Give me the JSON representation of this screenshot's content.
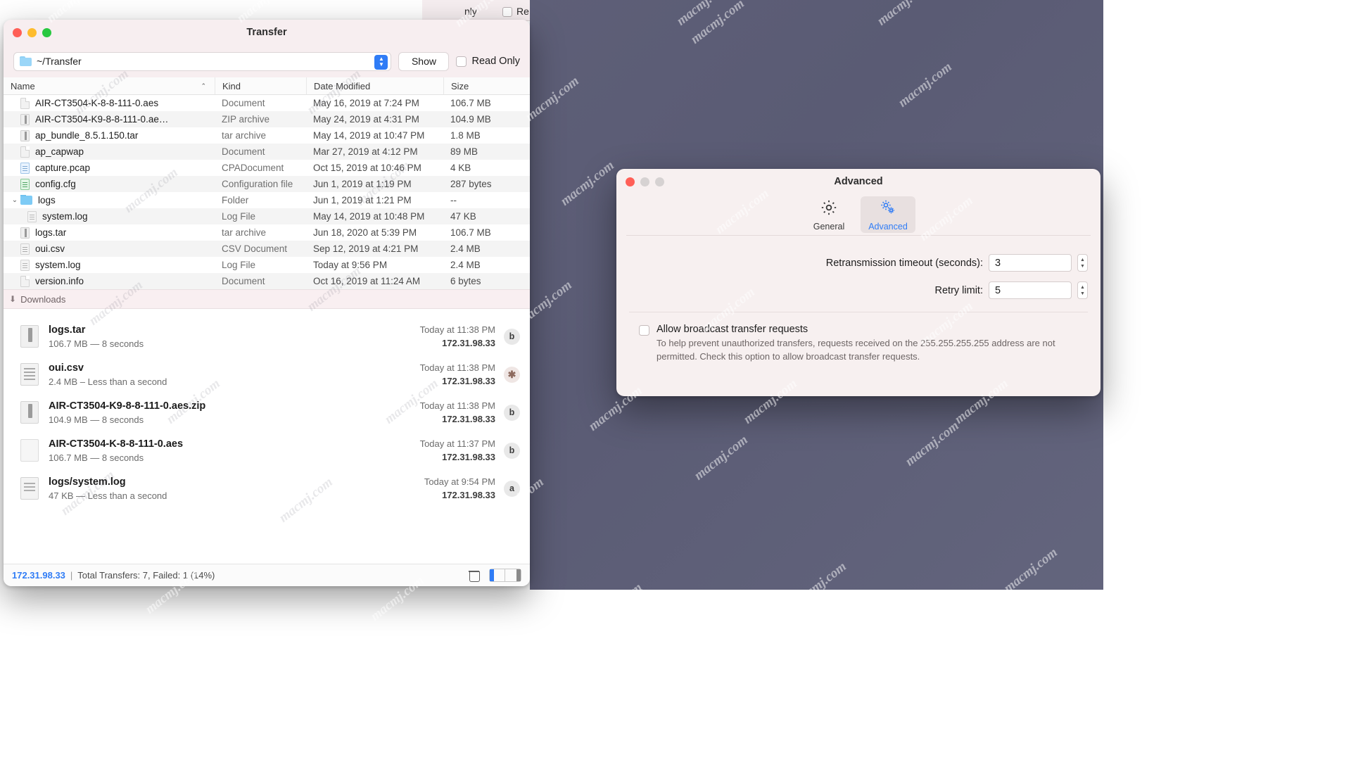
{
  "background": {
    "watermark_text": "macmj.com"
  },
  "behind_window": {
    "right_only_label": "nly",
    "readonly_label": "Re"
  },
  "transfer_window": {
    "title": "Transfer",
    "path": {
      "value": "~/Transfer",
      "folder_icon": "folder-icon"
    },
    "show_button": "Show",
    "read_only_label": "Read Only",
    "columns": [
      "Name",
      "Kind",
      "Date Modified",
      "Size"
    ],
    "sort_caret": "⌃",
    "files": [
      {
        "name": "AIR-CT3504-K-8-8-111-0.aes",
        "kind": "Document",
        "date": "May 16, 2019 at 7:24 PM",
        "size": "106.7 MB",
        "icon": "doc",
        "indent": 0,
        "disclosure": ""
      },
      {
        "name": "AIR-CT3504-K9-8-8-111-0.ae…",
        "kind": "ZIP archive",
        "date": "May 24, 2019 at 4:31 PM",
        "size": "104.9 MB",
        "icon": "zip",
        "indent": 0,
        "disclosure": ""
      },
      {
        "name": "ap_bundle_8.5.1.150.tar",
        "kind": "tar archive",
        "date": "May 14, 2019 at 10:47 PM",
        "size": "1.8 MB",
        "icon": "zip",
        "indent": 0,
        "disclosure": ""
      },
      {
        "name": "ap_capwap",
        "kind": "Document",
        "date": "Mar 27, 2019 at 4:12 PM",
        "size": "89 MB",
        "icon": "doc",
        "indent": 0,
        "disclosure": ""
      },
      {
        "name": "capture.pcap",
        "kind": "CPADocument",
        "date": "Oct 15, 2019 at 10:46 PM",
        "size": "4 KB",
        "icon": "pcap",
        "indent": 0,
        "disclosure": ""
      },
      {
        "name": "config.cfg",
        "kind": "Configuration file",
        "date": "Jun 1, 2019 at 1:19 PM",
        "size": "287 bytes",
        "icon": "cfg",
        "indent": 0,
        "disclosure": ""
      },
      {
        "name": "logs",
        "kind": "Folder",
        "date": "Jun 1, 2019 at 1:21 PM",
        "size": "--",
        "icon": "folder",
        "indent": 0,
        "disclosure": "⌄"
      },
      {
        "name": "system.log",
        "kind": "Log File",
        "date": "May 14, 2019 at 10:48 PM",
        "size": "47 KB",
        "icon": "log",
        "indent": 1,
        "disclosure": ""
      },
      {
        "name": "logs.tar",
        "kind": "tar archive",
        "date": "Jun 18, 2020 at 5:39 PM",
        "size": "106.7 MB",
        "icon": "zip",
        "indent": 0,
        "disclosure": ""
      },
      {
        "name": "oui.csv",
        "kind": "CSV Document",
        "date": "Sep 12, 2019 at 4:21 PM",
        "size": "2.4 MB",
        "icon": "csv",
        "indent": 0,
        "disclosure": ""
      },
      {
        "name": "system.log",
        "kind": "Log File",
        "date": "Today at 9:56 PM",
        "size": "2.4 MB",
        "icon": "log",
        "indent": 0,
        "disclosure": ""
      },
      {
        "name": "version.info",
        "kind": "Document",
        "date": "Oct 16, 2019 at 11:24 AM",
        "size": "6 bytes",
        "icon": "doc",
        "indent": 0,
        "disclosure": ""
      }
    ],
    "downloads": {
      "section_label": "Downloads",
      "arrow_icon": "download-arrow-icon",
      "items": [
        {
          "name": "logs.tar",
          "detail": "106.7 MB — 8 seconds",
          "time": "Today at 11:38 PM",
          "ip": "172.31.98.33",
          "badge": "b",
          "icon": "tar"
        },
        {
          "name": "oui.csv",
          "detail": "2.4 MB –  Less than a second",
          "time": "Today at 11:38 PM",
          "ip": "172.31.98.33",
          "badge": "✱",
          "icon": "csv"
        },
        {
          "name": "AIR-CT3504-K9-8-8-111-0.aes.zip",
          "detail": "104.9 MB — 8 seconds",
          "time": "Today at 11:38 PM",
          "ip": "172.31.98.33",
          "badge": "b",
          "icon": "tar"
        },
        {
          "name": "AIR-CT3504-K-8-8-111-0.aes",
          "detail": "106.7 MB — 8 seconds",
          "time": "Today at 11:37 PM",
          "ip": "172.31.98.33",
          "badge": "b",
          "icon": "doc"
        },
        {
          "name": "logs/system.log",
          "detail": "47 KB — Less than a second",
          "time": "Today at 9:54 PM",
          "ip": "172.31.98.33",
          "badge": "a",
          "icon": "log"
        }
      ]
    },
    "status_bar": {
      "ip": "172.31.98.33",
      "separator": "|",
      "summary": "Total Transfers: 7, Failed: 1 (14%)",
      "trash_icon": "trash-icon",
      "view_toggle_left_icon": "sidebar-left-icon",
      "view_toggle_right_icon": "sidebar-right-icon"
    }
  },
  "prefs_window": {
    "title": "Advanced",
    "toolbar": [
      {
        "label": "General",
        "icon": "gear-icon",
        "active": false
      },
      {
        "label": "Advanced",
        "icon": "gears-icon",
        "active": true
      }
    ],
    "fields": [
      {
        "label": "Retransmission timeout (seconds):",
        "value": "3"
      },
      {
        "label": "Retry limit:",
        "value": "5"
      }
    ],
    "broadcast": {
      "title": "Allow broadcast transfer requests",
      "description": "To help prevent unauthorized transfers, requests received on the 255.255.255.255 address are not permitted. Check this option to allow broadcast transfer requests.",
      "checked": false
    }
  },
  "colors": {
    "accent": "#2f7cf6",
    "titlebar": "#f7eef0",
    "prefs_bg": "#f7f0f0"
  }
}
